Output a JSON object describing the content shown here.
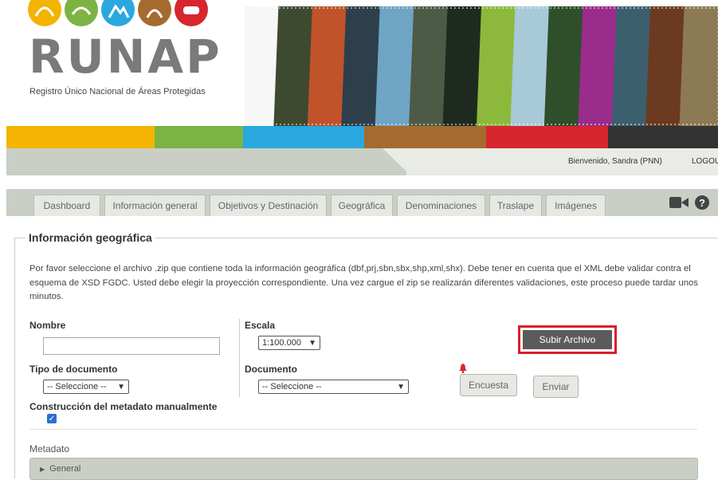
{
  "header": {
    "logo_text": "RUNAP",
    "logo_subtitle": "Registro Único Nacional de Áreas Protegidas",
    "logo_circle_colors": [
      "#f2b400",
      "#7cb342",
      "#29a8e0",
      "#a56b2e",
      "#d7262e"
    ],
    "banner_colors": [
      "#f7f7f7",
      "#3d4a30",
      "#c0532a",
      "#2d3f4a",
      "#6fa5c4",
      "#4d5a46",
      "#1e2a20",
      "#8cb93c",
      "#a7c9d8",
      "#2f4f2a",
      "#9a2c8c",
      "#3c5f6e",
      "#6b3a20",
      "#8c7a55"
    ]
  },
  "color_bar": [
    "#f2b400",
    "#7cb342",
    "#29a8e0",
    "#a56b2e",
    "#d7262e",
    "#333333"
  ],
  "topbar": {
    "welcome": "Bienvenido, Sandra (PNN)",
    "logout": "LOGOUT"
  },
  "tabs": [
    {
      "label": "Dashboard"
    },
    {
      "label": "Información general"
    },
    {
      "label": "Objetivos y Destinación"
    },
    {
      "label": "Geográfica"
    },
    {
      "label": "Denominaciones"
    },
    {
      "label": "Traslape"
    },
    {
      "label": "Imágenes"
    }
  ],
  "icons": {
    "video": "video-camera-icon",
    "help": "help-icon",
    "help_glyph": "?",
    "alert": "bell-icon"
  },
  "section": {
    "title": "Información geográfica",
    "description": "Por favor seleccione el archivo .zip que contiene toda la información geográfica (dbf,prj,sbn,sbx,shp,xml,shx). Debe tener en cuenta que el XML debe validar contra el esquema de XSD FGDC. Usted debe elegir la proyección correspondiente. Una vez cargue el zip se realizarán diferentes validaciones, este proceso puede tardar unos minutos."
  },
  "form": {
    "nombre_label": "Nombre",
    "nombre_value": "",
    "escala_label": "Escala",
    "escala_value": "1:100.000",
    "tipo_label": "Tipo de documento",
    "tipo_value": "-- Seleccione --",
    "documento_label": "Documento",
    "documento_value": "-- Seleccione --",
    "construccion_label": "Construcción del metadato manualmente",
    "construccion_checked": true,
    "subir_button": "Subir Archivo",
    "encuesta_button": "Encuesta",
    "enviar_button": "Enviar"
  },
  "metadata": {
    "label": "Metadato",
    "accordion_label": "General"
  }
}
